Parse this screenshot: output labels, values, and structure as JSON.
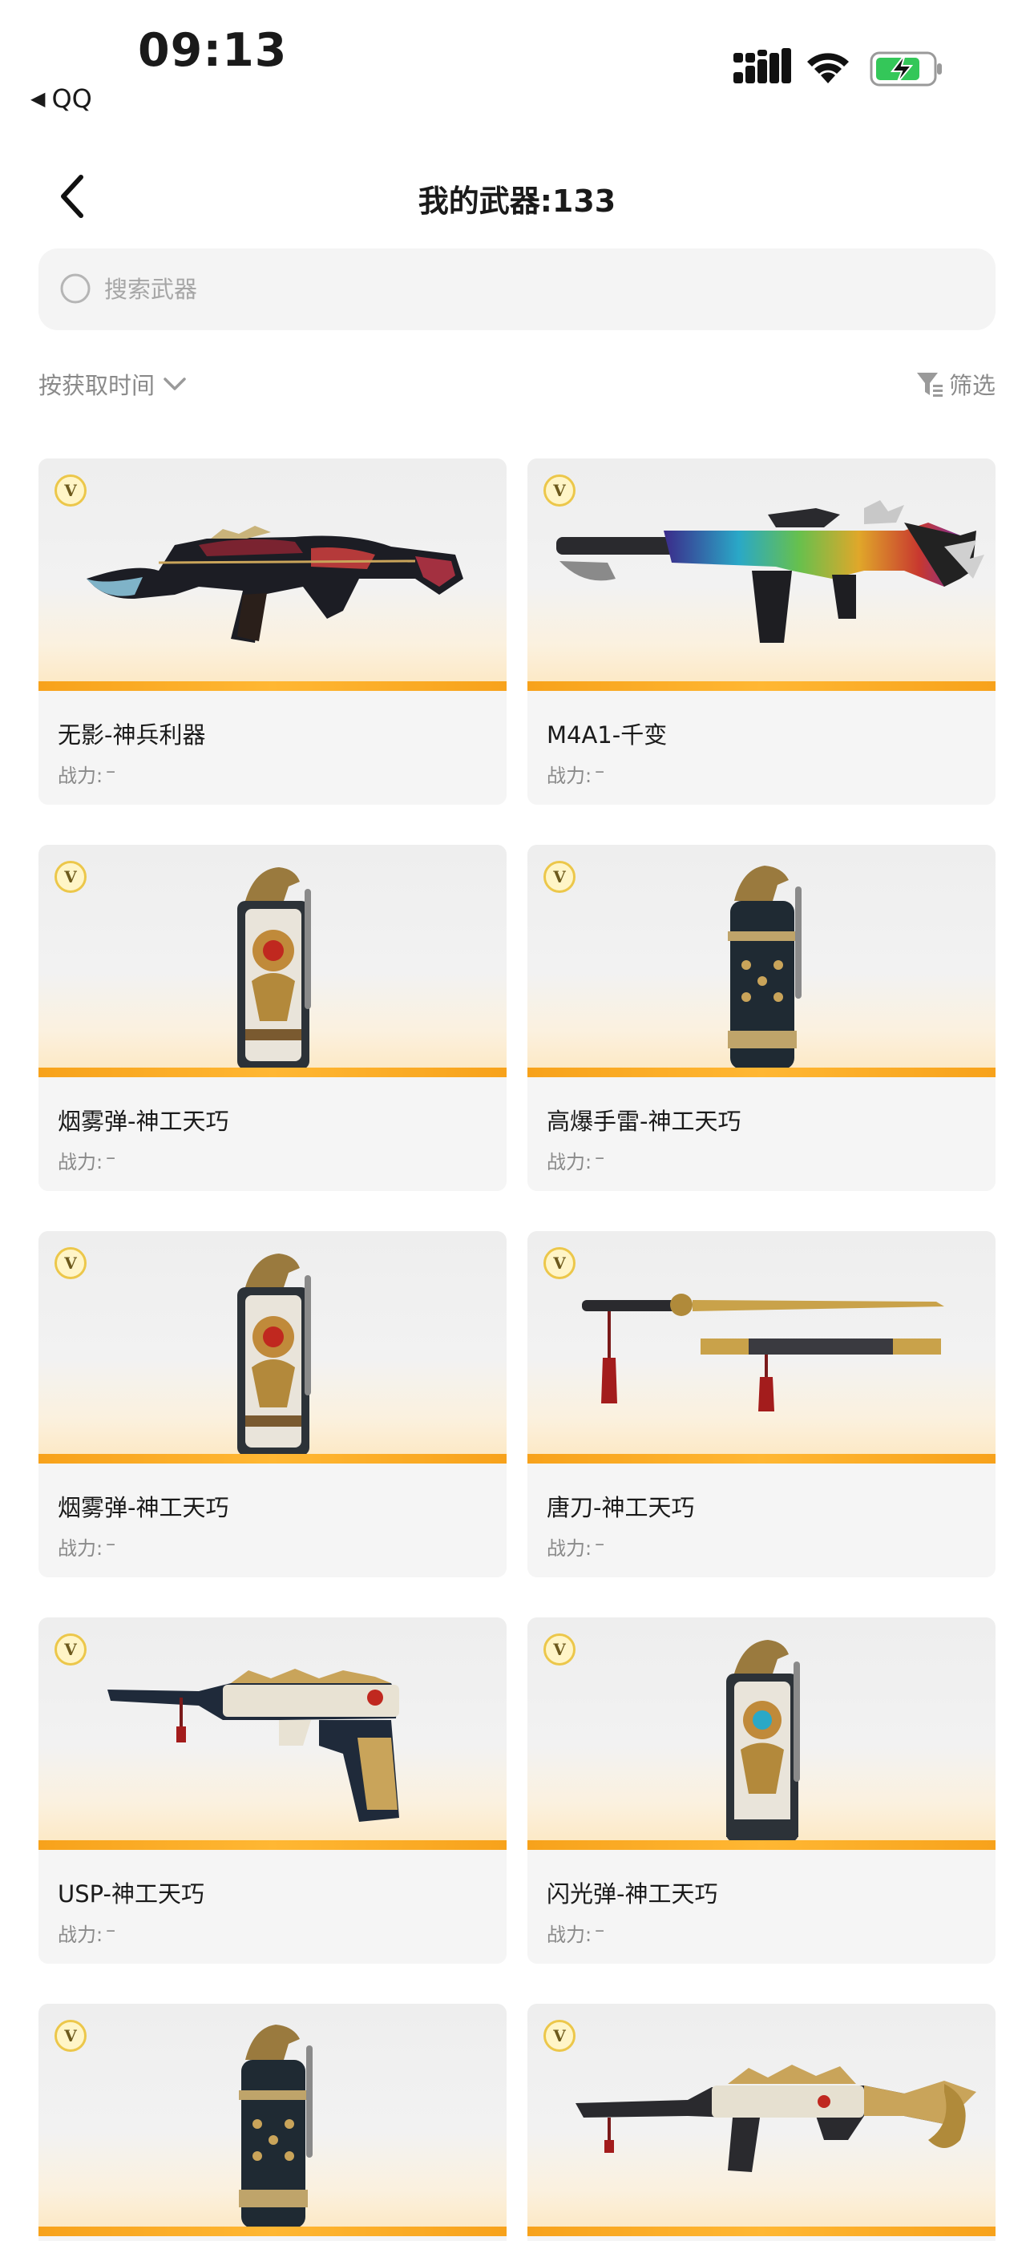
{
  "status_bar": {
    "time": "09:13",
    "back_app": "QQ",
    "back_icon": "triangle-left-icon",
    "icons": [
      "signal-icon",
      "wifi-icon",
      "battery-charging-icon"
    ],
    "battery_color": "#34c759"
  },
  "header": {
    "title": "我的武器:133",
    "back_icon": "chevron-left-icon"
  },
  "search": {
    "placeholder": "搜索武器",
    "value": ""
  },
  "sort": {
    "label": "按获取时间",
    "icon": "chevron-down-icon"
  },
  "filter": {
    "label": "筛选",
    "icon": "filter-icon"
  },
  "badge_letter": "V",
  "accent_color": "#f7a21b",
  "weapons": [
    {
      "name": "无影-神兵利器",
      "power_label": "战力:",
      "power_value": "–",
      "art": "rifle-dark-icon"
    },
    {
      "name": "M4A1-千变",
      "power_label": "战力:",
      "power_value": "–",
      "art": "rifle-rainbow-icon"
    },
    {
      "name": "烟雾弹-神工天巧",
      "power_label": "战力:",
      "power_value": "–",
      "art": "smoke-grenade-icon"
    },
    {
      "name": "高爆手雷-神工天巧",
      "power_label": "战力:",
      "power_value": "–",
      "art": "he-grenade-icon"
    },
    {
      "name": "烟雾弹-神工天巧",
      "power_label": "战力:",
      "power_value": "–",
      "art": "smoke-grenade-icon"
    },
    {
      "name": "唐刀-神工天巧",
      "power_label": "战力:",
      "power_value": "–",
      "art": "tang-sword-icon"
    },
    {
      "name": "USP-神工天巧",
      "power_label": "战力:",
      "power_value": "–",
      "art": "pistol-icon"
    },
    {
      "name": "闪光弹-神工天巧",
      "power_label": "战力:",
      "power_value": "–",
      "art": "flash-grenade-icon"
    },
    {
      "name": "",
      "power_label": "",
      "power_value": "",
      "art": "he-grenade-icon"
    },
    {
      "name": "",
      "power_label": "",
      "power_value": "",
      "art": "rifle-gold-icon"
    }
  ]
}
